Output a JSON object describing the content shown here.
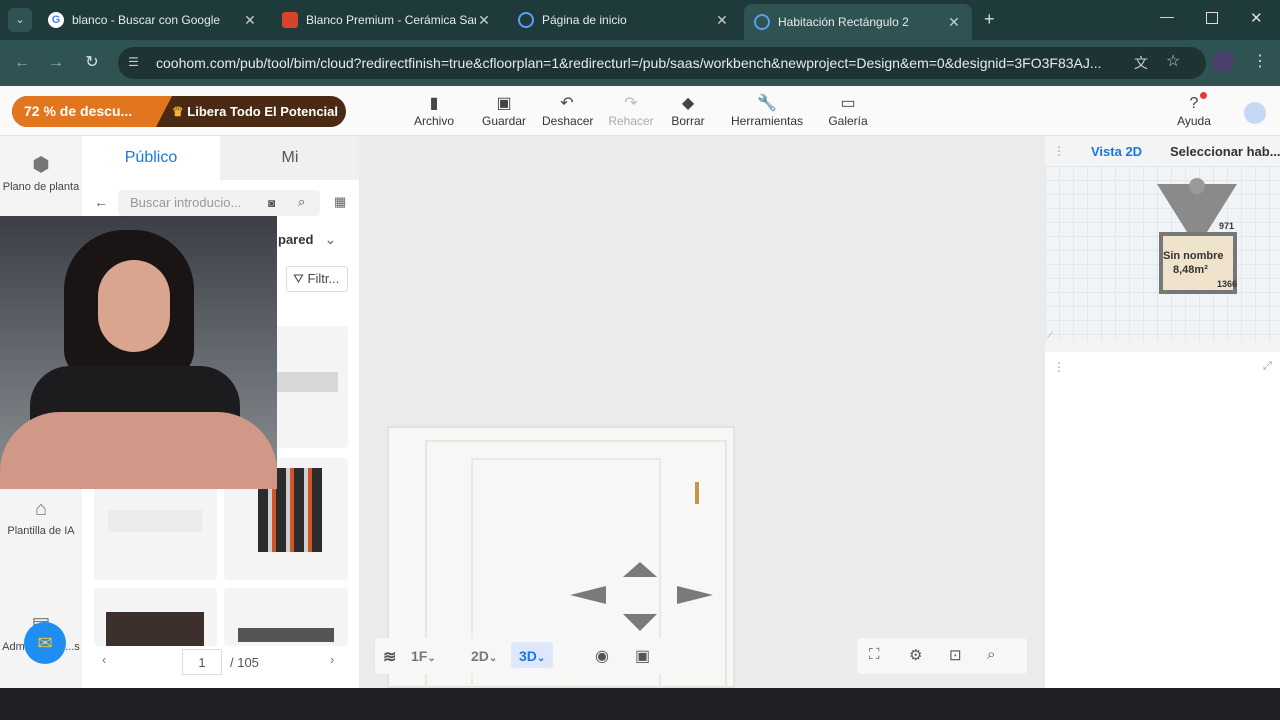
{
  "browser": {
    "tabs": [
      {
        "title": "blanco - Buscar con Google",
        "favicon_color": "#ffffff"
      },
      {
        "title": "Blanco Premium - Cerámica San Lo",
        "favicon_color": "#d6452b"
      },
      {
        "title": "Página de inicio",
        "favicon_color": "#3b82f6"
      },
      {
        "title": "Habitación Rectángulo 2",
        "favicon_color": "#3b82f6"
      }
    ],
    "url": "coohom.com/pub/tool/bim/cloud?redirectfinish=true&cfloorplan=1&redirecturl=/pub/saas/workbench&newproject=Design&em=0&designid=3FO3F83AJ..."
  },
  "app": {
    "promo": {
      "discount": "72 % de descu...",
      "cta": "Libera Todo El Potencial"
    },
    "toolbar": {
      "archivo": "Archivo",
      "guardar": "Guardar",
      "deshacer": "Deshacer",
      "rehacer": "Rehacer",
      "borrar": "Borrar",
      "herramientas": "Herramientas",
      "galeria": "Galería",
      "ayuda": "Ayuda"
    },
    "rail": {
      "plano": "Plano de planta",
      "plantilla": "Plantilla de IA",
      "adm": "Adm... or de ...s"
    },
    "panel": {
      "tab_public": "Público",
      "tab_mine": "Mi",
      "search_placeholder": "Buscar introducio...",
      "category": "pared",
      "filter": "Filtr...",
      "page_current": "1",
      "page_total": "/ 105"
    },
    "canvas": {
      "floor": "1F",
      "mode_2d": "2D",
      "mode_3d": "3D"
    },
    "right": {
      "tab_2d": "Vista 2D",
      "tab_select": "Seleccionar hab...",
      "room_name": "Sin nombre",
      "room_area": "8,48m²",
      "dim_top": "971",
      "dim_right": "1366"
    },
    "colors": {
      "accent": "#1677e6",
      "promo_orange": "#e2761f"
    }
  }
}
